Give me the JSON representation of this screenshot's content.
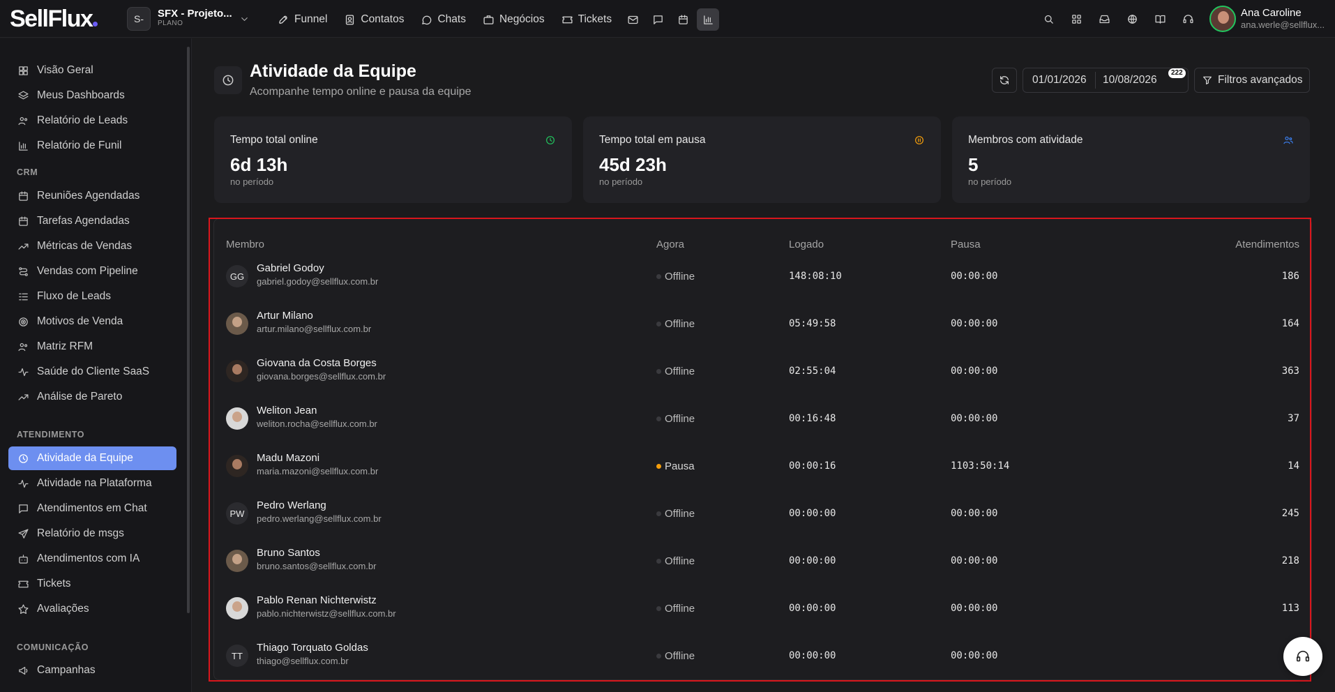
{
  "brand": {
    "logo": "SellFlux"
  },
  "project": {
    "avatar": "S-",
    "name": "SFX - Projeto...",
    "plan": "PLANO"
  },
  "nav": {
    "funnel": "Funnel",
    "contatos": "Contatos",
    "chats": "Chats",
    "negocios": "Negócios",
    "tickets": "Tickets"
  },
  "user": {
    "name": "Ana Caroline",
    "email": "ana.werle@sellflux..."
  },
  "sidebar": {
    "top": [
      "Visão Geral",
      "Meus Dashboards",
      "Relatório de Leads",
      "Relatório de Funil"
    ],
    "crm_heading": "CRM",
    "crm": [
      "Reuniões Agendadas",
      "Tarefas Agendadas",
      "Métricas de Vendas",
      "Vendas com Pipeline",
      "Fluxo de Leads",
      "Motivos de Venda",
      "Matriz RFM",
      "Saúde do Cliente SaaS",
      "Análise de Pareto"
    ],
    "atendimento_heading": "ATENDIMENTO",
    "atendimento": [
      "Atividade da Equipe",
      "Atividade na Plataforma",
      "Atendimentos em Chat",
      "Relatório de msgs",
      "Atendimentos com IA",
      "Tickets",
      "Avaliações"
    ],
    "comunicacao_heading": "COMUNICAÇÃO",
    "comunicacao": [
      "Campanhas"
    ]
  },
  "page": {
    "title": "Atividade da Equipe",
    "subtitle": "Acompanhe tempo online e pausa da equipe",
    "date_start": "01/01/2026",
    "date_end": "10/08/2026",
    "badge": "222",
    "filters_label": "Filtros avançados"
  },
  "cards": [
    {
      "label": "Tempo total online",
      "value": "6d 13h",
      "note": "no período",
      "color": "#22c55e"
    },
    {
      "label": "Tempo total em pausa",
      "value": "45d 23h",
      "note": "no período",
      "color": "#f59e0b"
    },
    {
      "label": "Membros com atividade",
      "value": "5",
      "note": "no período",
      "color": "#3b82f6"
    }
  ],
  "table": {
    "headers": {
      "member": "Membro",
      "now": "Agora",
      "logged": "Logado",
      "pause": "Pausa",
      "count": "Atendimentos"
    },
    "rows": [
      {
        "initials": "GG",
        "name": "Gabriel Godoy",
        "email": "gabriel.godoy@sellflux.com.br",
        "status": "Offline",
        "logged": "148:08:10",
        "pause": "00:00:00",
        "count": "186"
      },
      {
        "initials": "",
        "name": "Artur Milano",
        "email": "artur.milano@sellflux.com.br",
        "status": "Offline",
        "logged": "05:49:58",
        "pause": "00:00:00",
        "count": "164"
      },
      {
        "initials": "",
        "name": "Giovana da Costa Borges",
        "email": "giovana.borges@sellflux.com.br",
        "status": "Offline",
        "logged": "02:55:04",
        "pause": "00:00:00",
        "count": "363"
      },
      {
        "initials": "",
        "name": "Weliton Jean",
        "email": "weliton.rocha@sellflux.com.br",
        "status": "Offline",
        "logged": "00:16:48",
        "pause": "00:00:00",
        "count": "37"
      },
      {
        "initials": "",
        "name": "Madu Mazoni",
        "email": "maria.mazoni@sellflux.com.br",
        "status": "Pausa",
        "logged": "00:00:16",
        "pause": "1103:50:14",
        "count": "14"
      },
      {
        "initials": "PW",
        "name": "Pedro Werlang",
        "email": "pedro.werlang@sellflux.com.br",
        "status": "Offline",
        "logged": "00:00:00",
        "pause": "00:00:00",
        "count": "245"
      },
      {
        "initials": "",
        "name": "Bruno Santos",
        "email": "bruno.santos@sellflux.com.br",
        "status": "Offline",
        "logged": "00:00:00",
        "pause": "00:00:00",
        "count": "218"
      },
      {
        "initials": "",
        "name": "Pablo Renan Nichterwistz",
        "email": "pablo.nichterwistz@sellflux.com.br",
        "status": "Offline",
        "logged": "00:00:00",
        "pause": "00:00:00",
        "count": "113"
      },
      {
        "initials": "TT",
        "name": "Thiago Torquato Goldas",
        "email": "thiago@sellflux.com.br",
        "status": "Offline",
        "logged": "00:00:00",
        "pause": "00:00:00",
        "count": ""
      }
    ]
  }
}
